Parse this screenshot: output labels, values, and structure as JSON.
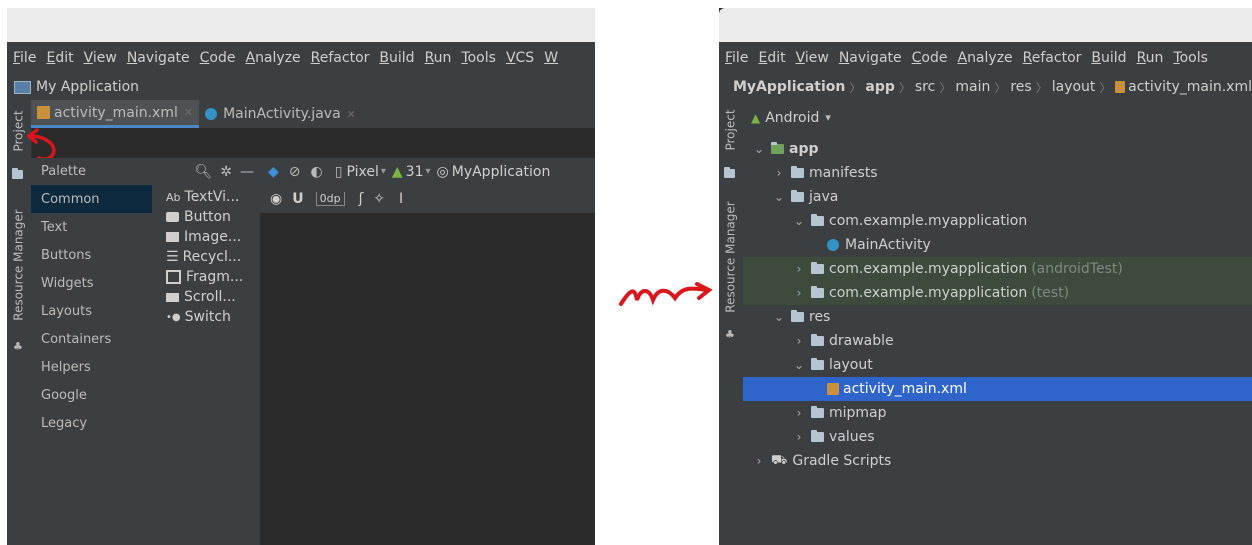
{
  "left": {
    "menu": [
      "File",
      "Edit",
      "View",
      "Navigate",
      "Code",
      "Analyze",
      "Refactor",
      "Build",
      "Run",
      "Tools",
      "VCS",
      "W"
    ],
    "project_title": "My Application",
    "side_labels": {
      "project": "Project",
      "resource_manager": "Resource Manager"
    },
    "tabs": [
      {
        "label": "activity_main.xml",
        "icon": "layout-file-icon"
      },
      {
        "label": "MainActivity.java",
        "icon": "java-class-icon"
      }
    ],
    "palette": {
      "title": "Palette",
      "categories": [
        "Common",
        "Text",
        "Buttons",
        "Widgets",
        "Layouts",
        "Containers",
        "Helpers",
        "Google",
        "Legacy"
      ],
      "selected_category": "Common",
      "widgets": [
        {
          "icon": "Ab",
          "label": "TextVi..."
        },
        {
          "icon": "button-icon",
          "label": "Button"
        },
        {
          "icon": "image-icon",
          "label": "Image..."
        },
        {
          "icon": "list-icon",
          "label": "Recycl..."
        },
        {
          "icon": "fragment-icon",
          "label": "Fragm..."
        },
        {
          "icon": "scroll-icon",
          "label": "Scroll..."
        },
        {
          "icon": "switch-icon",
          "label": "Switch"
        }
      ]
    },
    "toolbar": {
      "device": "Pixel",
      "api": "31",
      "app": "MyApplication",
      "margin": "0dp"
    }
  },
  "right": {
    "menu": [
      "File",
      "Edit",
      "View",
      "Navigate",
      "Code",
      "Analyze",
      "Refactor",
      "Build",
      "Run",
      "Tools"
    ],
    "breadcrumb": [
      "MyApplication",
      "app",
      "src",
      "main",
      "res",
      "layout",
      "activity_main.xml"
    ],
    "side_labels": {
      "project": "Project",
      "resource_manager": "Resource Manager"
    },
    "view_selector": "Android",
    "tree": [
      {
        "label": "app",
        "level": 0,
        "arrow": "open",
        "bold": true
      },
      {
        "label": "manifests",
        "level": 1,
        "arrow": "closed"
      },
      {
        "label": "java",
        "level": 1,
        "arrow": "open"
      },
      {
        "label": "com.example.myapplication",
        "level": 2,
        "arrow": "open",
        "suffix": ""
      },
      {
        "label": "MainActivity",
        "level": 3,
        "arrow": "none",
        "kind": "class"
      },
      {
        "label": "com.example.myapplication",
        "level": 2,
        "arrow": "closed",
        "suffix": "(androidTest)",
        "green": true
      },
      {
        "label": "com.example.myapplication",
        "level": 2,
        "arrow": "closed",
        "suffix": "(test)",
        "green": true
      },
      {
        "label": "res",
        "level": 1,
        "arrow": "open"
      },
      {
        "label": "drawable",
        "level": 2,
        "arrow": "closed"
      },
      {
        "label": "layout",
        "level": 2,
        "arrow": "open"
      },
      {
        "label": "activity_main.xml",
        "level": 3,
        "arrow": "none",
        "kind": "layout-file",
        "selected": true
      },
      {
        "label": "mipmap",
        "level": 2,
        "arrow": "closed"
      },
      {
        "label": "values",
        "level": 2,
        "arrow": "closed"
      },
      {
        "label": "Gradle Scripts",
        "level": 0,
        "arrow": "closed",
        "kind": "gradle"
      }
    ]
  },
  "colors": {
    "accent_arrow": "#d9161b",
    "selection": "#2f65ca",
    "ide_bg": "#2b2b2b",
    "panel_bg": "#3c3f41"
  }
}
